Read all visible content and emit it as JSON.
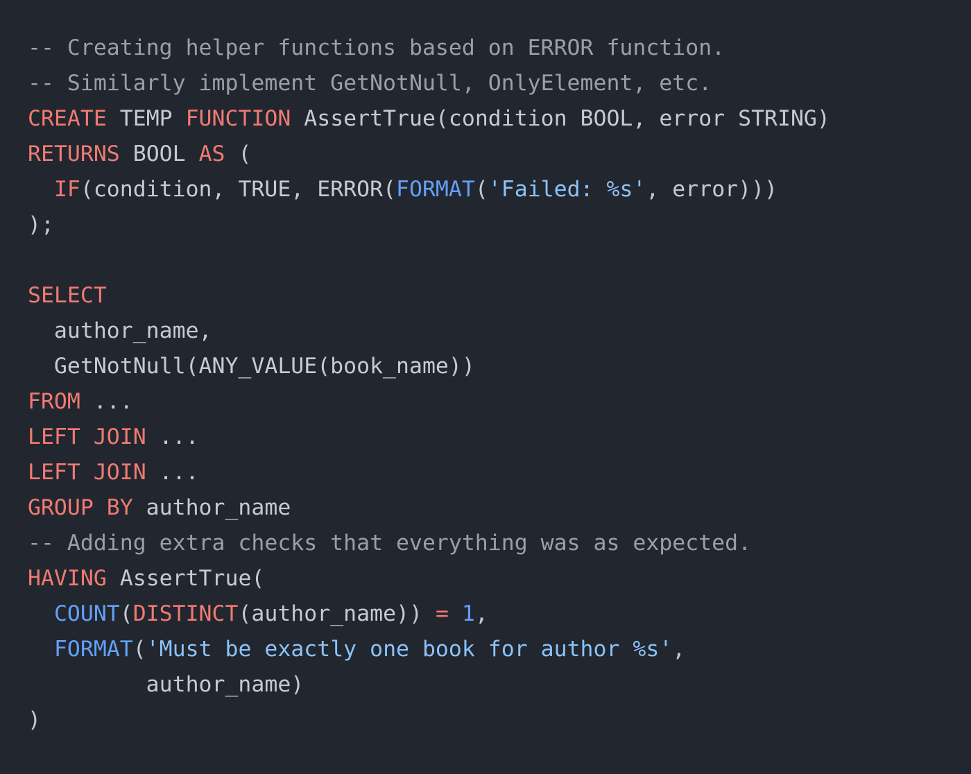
{
  "theme": {
    "background": "#22262f",
    "default_text": "#c3cbd4",
    "keyword": "#f07a72",
    "function": "#63a0f7",
    "string": "#8cc2f7",
    "number": "#63a0f7",
    "operator": "#f07a72",
    "comment": "#98a0ab"
  },
  "language": "sql",
  "code": {
    "full_text": "-- Creating helper functions based on ERROR function.\n-- Similarly implement GetNotNull, OnlyElement, etc.\nCREATE TEMP FUNCTION AssertTrue(condition BOOL, error STRING)\nRETURNS BOOL AS (\n  IF(condition, TRUE, ERROR(FORMAT('Failed: %s', error)))\n);\n\nSELECT\n  author_name,\n  GetNotNull(ANY_VALUE(book_name))\nFROM ...\nLEFT JOIN ...\nLEFT JOIN ...\nGROUP BY author_name\n-- Adding extra checks that everything was as expected.\nHAVING AssertTrue(\n  COUNT(DISTINCT(author_name)) = 1,\n  FORMAT('Must be exactly one book for author %s',\n         author_name)\n)",
    "lines": [
      {
        "index": 0,
        "text": "-- Creating helper functions based on ERROR function.",
        "tokens": [
          {
            "t": "-- Creating helper functions based on ERROR function.",
            "c": "cmt"
          }
        ]
      },
      {
        "index": 1,
        "text": "-- Similarly implement GetNotNull, OnlyElement, etc.",
        "tokens": [
          {
            "t": "-- Similarly implement GetNotNull, OnlyElement, etc.",
            "c": "cmt"
          }
        ]
      },
      {
        "index": 2,
        "text": "CREATE TEMP FUNCTION AssertTrue(condition BOOL, error STRING)",
        "tokens": [
          {
            "t": "CREATE",
            "c": "kw"
          },
          {
            "t": " TEMP ",
            "c": "id"
          },
          {
            "t": "FUNCTION",
            "c": "kw"
          },
          {
            "t": " AssertTrue(condition BOOL, error STRING)",
            "c": "id"
          }
        ]
      },
      {
        "index": 3,
        "text": "RETURNS BOOL AS (",
        "tokens": [
          {
            "t": "RETURNS",
            "c": "kw"
          },
          {
            "t": " BOOL ",
            "c": "id"
          },
          {
            "t": "AS",
            "c": "kw"
          },
          {
            "t": " (",
            "c": "id"
          }
        ]
      },
      {
        "index": 4,
        "text": "  IF(condition, TRUE, ERROR(FORMAT('Failed: %s', error)))",
        "tokens": [
          {
            "t": "  ",
            "c": "id"
          },
          {
            "t": "IF",
            "c": "kw"
          },
          {
            "t": "(condition, TRUE, ERROR(",
            "c": "id"
          },
          {
            "t": "FORMAT",
            "c": "fn"
          },
          {
            "t": "(",
            "c": "id"
          },
          {
            "t": "'Failed: %s'",
            "c": "str"
          },
          {
            "t": ", error)))",
            "c": "id"
          }
        ]
      },
      {
        "index": 5,
        "text": ");",
        "tokens": [
          {
            "t": ");",
            "c": "id"
          }
        ]
      },
      {
        "index": 6,
        "text": "",
        "tokens": []
      },
      {
        "index": 7,
        "text": "SELECT",
        "tokens": [
          {
            "t": "SELECT",
            "c": "kw"
          }
        ]
      },
      {
        "index": 8,
        "text": "  author_name,",
        "tokens": [
          {
            "t": "  author_name,",
            "c": "id"
          }
        ]
      },
      {
        "index": 9,
        "text": "  GetNotNull(ANY_VALUE(book_name))",
        "tokens": [
          {
            "t": "  GetNotNull(ANY_VALUE(book_name))",
            "c": "id"
          }
        ]
      },
      {
        "index": 10,
        "text": "FROM ...",
        "tokens": [
          {
            "t": "FROM",
            "c": "kw"
          },
          {
            "t": " ...",
            "c": "id"
          }
        ]
      },
      {
        "index": 11,
        "text": "LEFT JOIN ...",
        "tokens": [
          {
            "t": "LEFT JOIN",
            "c": "kw"
          },
          {
            "t": " ...",
            "c": "id"
          }
        ]
      },
      {
        "index": 12,
        "text": "LEFT JOIN ...",
        "tokens": [
          {
            "t": "LEFT JOIN",
            "c": "kw"
          },
          {
            "t": " ...",
            "c": "id"
          }
        ]
      },
      {
        "index": 13,
        "text": "GROUP BY author_name",
        "tokens": [
          {
            "t": "GROUP BY",
            "c": "kw"
          },
          {
            "t": " author_name",
            "c": "id"
          }
        ]
      },
      {
        "index": 14,
        "text": "-- Adding extra checks that everything was as expected.",
        "tokens": [
          {
            "t": "-- Adding extra checks that everything was as expected.",
            "c": "cmt"
          }
        ]
      },
      {
        "index": 15,
        "text": "HAVING AssertTrue(",
        "tokens": [
          {
            "t": "HAVING",
            "c": "kw"
          },
          {
            "t": " AssertTrue(",
            "c": "id"
          }
        ]
      },
      {
        "index": 16,
        "text": "  COUNT(DISTINCT(author_name)) = 1,",
        "tokens": [
          {
            "t": "  ",
            "c": "id"
          },
          {
            "t": "COUNT",
            "c": "fn"
          },
          {
            "t": "(",
            "c": "id"
          },
          {
            "t": "DISTINCT",
            "c": "kw"
          },
          {
            "t": "(author_name)) ",
            "c": "id"
          },
          {
            "t": "=",
            "c": "op"
          },
          {
            "t": " ",
            "c": "id"
          },
          {
            "t": "1",
            "c": "num"
          },
          {
            "t": ",",
            "c": "id"
          }
        ]
      },
      {
        "index": 17,
        "text": "  FORMAT('Must be exactly one book for author %s',",
        "tokens": [
          {
            "t": "  ",
            "c": "id"
          },
          {
            "t": "FORMAT",
            "c": "fn"
          },
          {
            "t": "(",
            "c": "id"
          },
          {
            "t": "'Must be exactly one book for author %s'",
            "c": "str"
          },
          {
            "t": ",",
            "c": "id"
          }
        ]
      },
      {
        "index": 18,
        "text": "         author_name)",
        "tokens": [
          {
            "t": "         author_name)",
            "c": "id"
          }
        ]
      },
      {
        "index": 19,
        "text": ")",
        "tokens": [
          {
            "t": ")",
            "c": "id"
          }
        ]
      }
    ]
  }
}
